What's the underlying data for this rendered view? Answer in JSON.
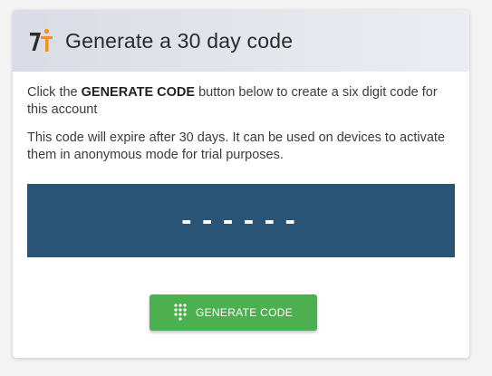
{
  "header": {
    "title": "Generate a 30 day code",
    "logo_icon": "app-logo-icon"
  },
  "body": {
    "para1_pre": "Click the ",
    "para1_bold": "GENERATE CODE",
    "para1_post": " button below to create a six digit code for this account",
    "para2": "This code will expire after 30 days. It can be used on devices to activate them in anonymous mode for trial purposes."
  },
  "code": {
    "value": "------"
  },
  "button": {
    "label": "GENERATE CODE",
    "icon": "dialpad-icon"
  },
  "colors": {
    "header_bg": "#dfe2e9",
    "code_bg": "#2a5475",
    "button_bg": "#4caf50",
    "logo_dark": "#2b2b2b",
    "logo_orange": "#f39224"
  }
}
